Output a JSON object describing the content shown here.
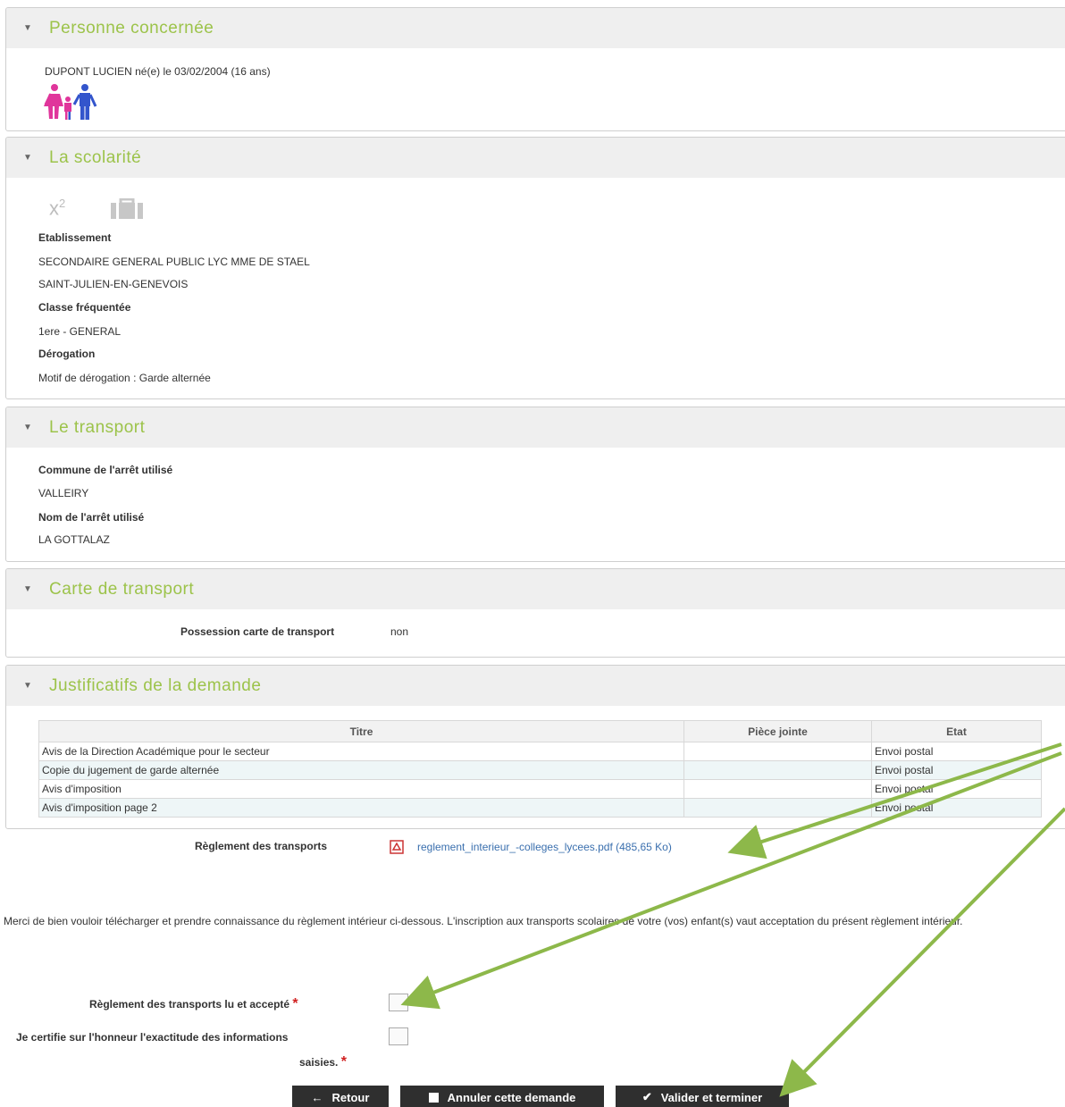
{
  "person": {
    "title": "Personne concernée",
    "info": "DUPONT LUCIEN né(e) le 03/02/2004 (16 ans)"
  },
  "scolarite": {
    "title": "La scolarité",
    "etab_label": "Etablissement",
    "etab_name": "SECONDAIRE GENERAL PUBLIC LYC MME DE STAEL",
    "etab_city": "SAINT-JULIEN-EN-GENEVOIS",
    "classe_label": "Classe fréquentée",
    "classe_value": "1ere - GENERAL",
    "derog_label": "Dérogation",
    "derog_value": "Motif de dérogation : Garde alternée"
  },
  "transport": {
    "title": "Le transport",
    "commune_label": "Commune de l'arrêt utilisé",
    "commune_value": "VALLEIRY",
    "arret_label": "Nom de l'arrêt utilisé",
    "arret_value": "LA GOTTALAZ"
  },
  "carte": {
    "title": "Carte de transport",
    "label": "Possession carte de transport",
    "value": "non"
  },
  "justificatifs": {
    "title": "Justificatifs de la demande",
    "headers": [
      "Titre",
      "Pièce jointe",
      "Etat"
    ],
    "rows": [
      [
        "Avis de la Direction Académique pour le secteur",
        "",
        "Envoi postal"
      ],
      [
        "Copie du jugement de garde alternée",
        "",
        "Envoi postal"
      ],
      [
        "Avis d'imposition",
        "",
        "Envoi postal"
      ],
      [
        "Avis d'imposition page 2",
        "",
        "Envoi postal"
      ]
    ]
  },
  "reglement": {
    "label": "Règlement des transports",
    "link": "reglement_interieur_-colleges_lycees.pdf (485,65 Ko)",
    "notice": "Merci de bien vouloir télécharger et prendre connaissance du règlement intérieur ci-dessous. L'inscription aux transports scolaires de votre (vos) enfant(s) vaut acceptation du présent règlement intérieur.",
    "accept_label": "Règlement des transports lu et accepté",
    "certify_label_1": "Je certifie sur l'honneur l'exactitude des informations",
    "certify_label_2": "saisies.",
    "required_mark": "*"
  },
  "buttons": {
    "back": "Retour",
    "cancel": "Annuler cette demande",
    "validate": "Valider et terminer"
  },
  "colors": {
    "section_title": "#9cc34a",
    "arrow": "#8db84a",
    "required": "#d02020",
    "button_bg": "#2f2f2f"
  }
}
